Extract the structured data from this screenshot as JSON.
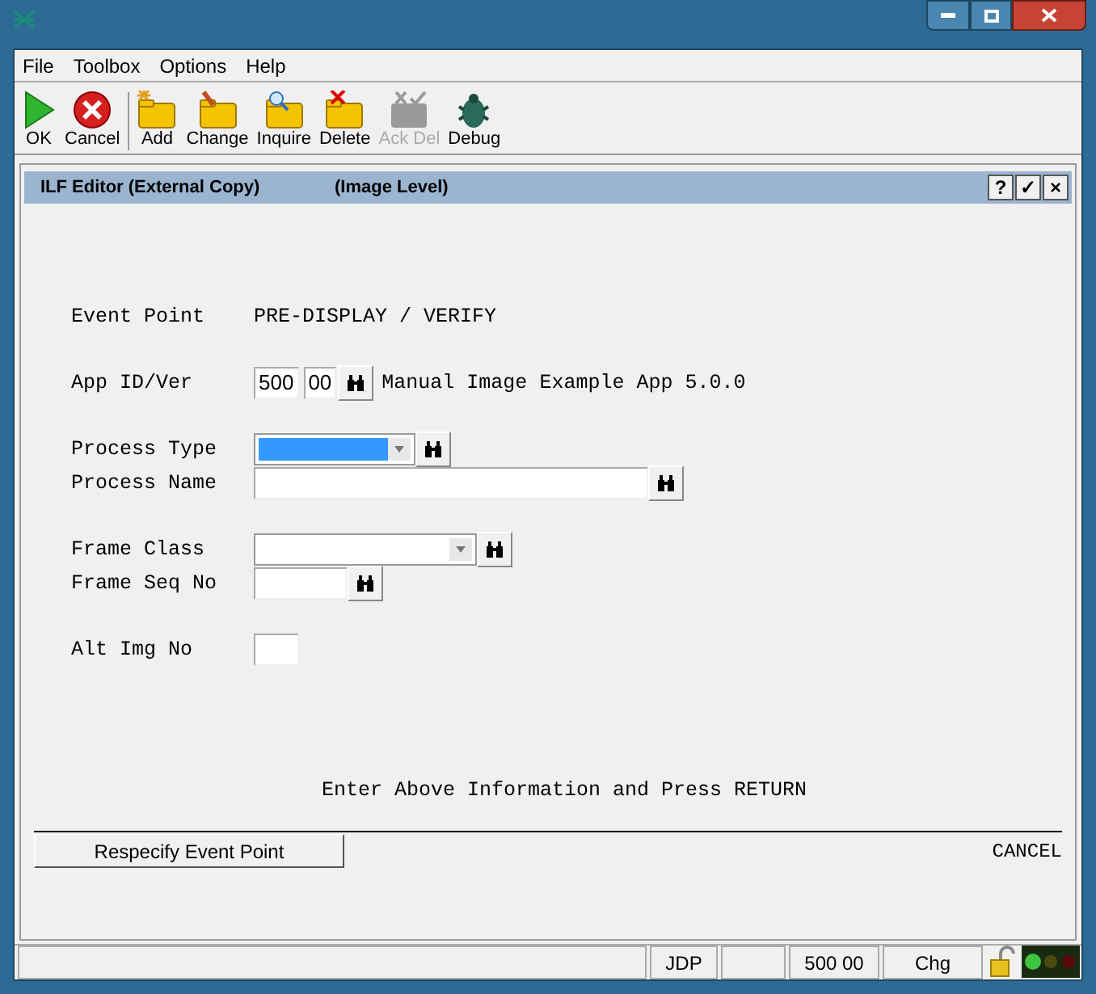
{
  "menu": [
    "File",
    "Toolbox",
    "Options",
    "Help"
  ],
  "toolbar": [
    {
      "kind": "ok",
      "label": "OK",
      "disabled": false
    },
    {
      "kind": "cancel",
      "label": "Cancel",
      "disabled": false
    },
    {
      "kind": "add",
      "label": "Add",
      "disabled": false
    },
    {
      "kind": "change",
      "label": "Change",
      "disabled": false
    },
    {
      "kind": "inquire",
      "label": "Inquire",
      "disabled": false
    },
    {
      "kind": "delete",
      "label": "Delete",
      "disabled": false
    },
    {
      "kind": "ackdel",
      "label": "Ack Del",
      "disabled": true
    },
    {
      "kind": "debug",
      "label": "Debug",
      "disabled": false
    }
  ],
  "panel": {
    "title": "ILF Editor (External Copy)",
    "subtitle": "(Image Level)",
    "buttons": [
      "?",
      "✓",
      "×"
    ]
  },
  "form": [
    [
      {
        "label": "Event Point",
        "kind": "static",
        "value": "PRE-DISPLAY / VERIFY"
      }
    ],
    [
      {
        "label": "App ID/Ver",
        "kind": "appid",
        "values": [
          "500",
          "00"
        ],
        "lookup": true,
        "description": "Manual Image Example App 5.0.0"
      }
    ],
    [
      {
        "label": "Process Type",
        "kind": "combo",
        "selected": true,
        "lookup": true
      },
      {
        "label": "Process Name",
        "kind": "text",
        "lookup": true
      }
    ],
    [
      {
        "label": "Frame Class",
        "kind": "combo",
        "selected": false,
        "lookup": true
      },
      {
        "label": "Frame Seq No",
        "kind": "text",
        "lookup": true
      }
    ],
    [
      {
        "label": "Alt Img No",
        "kind": "text",
        "lookup": false
      }
    ]
  ],
  "message": "Enter Above Information and Press RETURN",
  "footer": {
    "button": "Respecify Event Point",
    "cancel": "CANCEL"
  },
  "status_bar": [
    "JDP",
    "500 00",
    "Chg"
  ]
}
